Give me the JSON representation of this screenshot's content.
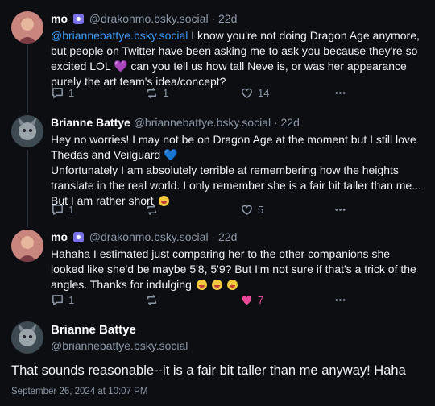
{
  "colors": {
    "background": "#0c0e12",
    "accent": "#3b9af8",
    "like_active": "#ec4899",
    "muted": "#8b97a6"
  },
  "posts": [
    {
      "name": "mo",
      "handle": "@drakonmo.bsky.social",
      "time": "· 22d",
      "mention": "@briannebattye.bsky.social",
      "text_a": " I know you're not doing Dragon Age anymore, but people on Twitter have been asking me to ask you because they're so excited LOL ",
      "emoji_a": "💜",
      "text_b": " can you tell us how tall Neve is, or was her appearance purely the art team's idea/concept?",
      "replies": "1",
      "reposts": "1",
      "likes": "14"
    },
    {
      "name": "Brianne Battye",
      "handle": "@briannebattye.bsky.social",
      "time": "· 22d",
      "line1": "Hey no worries! I may not be on Dragon Age at the moment but I still love Thedas and Veilguard ",
      "emoji_a": "💙",
      "line2": "Unfortunately I am absolutely terrible at remembering how the heights translate in the real world. I only remember she is a fair bit taller than me... But I am rather short ",
      "replies": "1",
      "reposts": "",
      "likes": "5"
    },
    {
      "name": "mo",
      "handle": "@drakonmo.bsky.social",
      "time": "· 22d",
      "text": "Hahaha I estimated just comparing her to the other companions she looked like she'd be maybe 5'8, 5'9? But I'm not sure if that's a trick of the angles. Thanks for indulging ",
      "replies": "1",
      "reposts": "",
      "likes": "7"
    }
  ],
  "main": {
    "name": "Brianne Battye",
    "handle": "@briannebattye.bsky.social",
    "text": "That sounds reasonable--it is a fair bit taller than me anyway! Haha",
    "timestamp": "September 26, 2024 at 10:07 PM"
  }
}
